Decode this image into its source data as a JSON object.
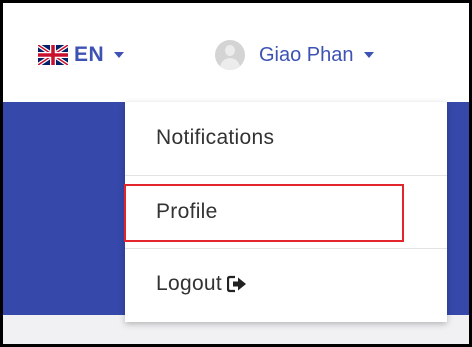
{
  "header": {
    "language": {
      "code": "EN",
      "flag_icon": "uk-flag-icon",
      "caret_icon": "caret-down-icon"
    },
    "user": {
      "name": "Giao Phan",
      "avatar_icon": "user-avatar-icon",
      "caret_icon": "caret-down-icon"
    }
  },
  "user_menu": {
    "items": [
      {
        "label": "Notifications"
      },
      {
        "label": "Profile",
        "highlighted": true
      },
      {
        "label": "Logout",
        "icon": "sign-out-icon"
      }
    ]
  },
  "colors": {
    "accent": "#3d52b3",
    "band": "#3649ab",
    "highlight_border": "#e0262c",
    "frame": "#000000"
  }
}
